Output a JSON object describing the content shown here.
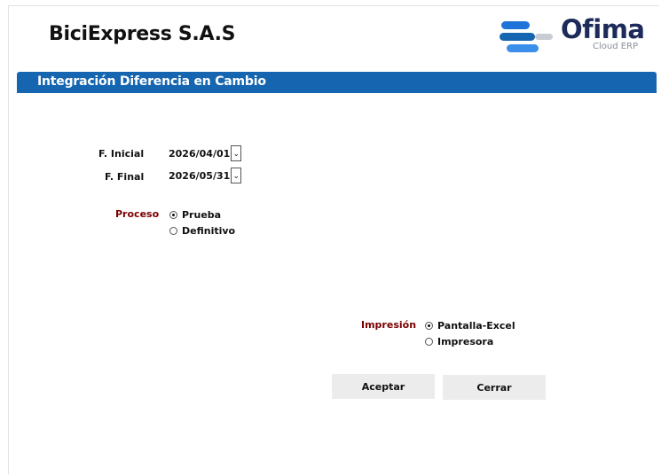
{
  "header": {
    "company_name": "BiciExpress S.A.S",
    "logo_name": "Ofima",
    "logo_tagline": "Cloud ERP",
    "logo_icon": "ofima-logo-icon",
    "brand_color": "#1565b0"
  },
  "form": {
    "title": "Integración Diferencia en Cambio",
    "fecha_inicial": {
      "label": "F. Inicial",
      "value": "2026/04/01",
      "dropdown_icon": "chevron-down-icon"
    },
    "fecha_final": {
      "label": "F. Final",
      "value": "2026/05/31",
      "dropdown_icon": "chevron-down-icon"
    },
    "proceso": {
      "label": "Proceso",
      "options": [
        {
          "label": "Prueba",
          "selected": true
        },
        {
          "label": "Definitivo",
          "selected": false
        }
      ]
    },
    "impresion": {
      "label": "Impresión",
      "options": [
        {
          "label": "Pantalla-Excel",
          "selected": true
        },
        {
          "label": "Impresora",
          "selected": false
        }
      ]
    }
  },
  "actions": {
    "accept_label": "Aceptar",
    "close_label": "Cerrar"
  }
}
